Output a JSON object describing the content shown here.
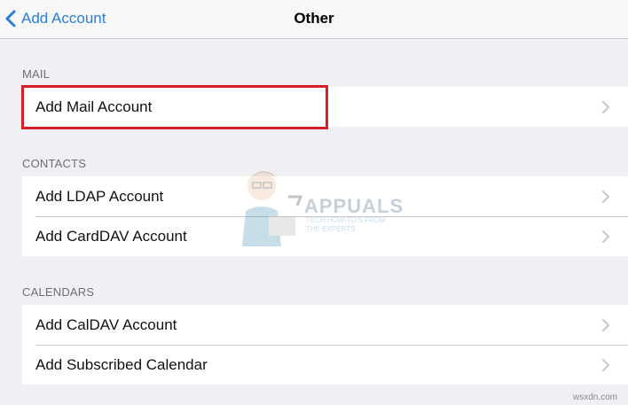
{
  "navbar": {
    "back_label": "Add Account",
    "title": "Other"
  },
  "sections": {
    "mail": {
      "header": "MAIL",
      "items": [
        {
          "label": "Add Mail Account"
        }
      ]
    },
    "contacts": {
      "header": "CONTACTS",
      "items": [
        {
          "label": "Add LDAP Account"
        },
        {
          "label": "Add CardDAV Account"
        }
      ]
    },
    "calendars": {
      "header": "CALENDARS",
      "items": [
        {
          "label": "Add CalDAV Account"
        },
        {
          "label": "Add Subscribed Calendar"
        }
      ]
    }
  },
  "annotation": {
    "highlight_color": "#d61f26",
    "highlighted_item": "Add Mail Account"
  },
  "watermark": {
    "brand": "APPUALS",
    "tagline": "TECH HOW-TO'S FROM THE EXPERTS"
  },
  "site_mark": "wsxdn.com",
  "colors": {
    "accent": "#2a7fd4",
    "background": "#efeff4",
    "section_header": "#6d6d72",
    "chevron": "#c7c7cc"
  },
  "icons": {
    "back": "chevron-left-icon",
    "disclosure": "chevron-right-icon"
  }
}
